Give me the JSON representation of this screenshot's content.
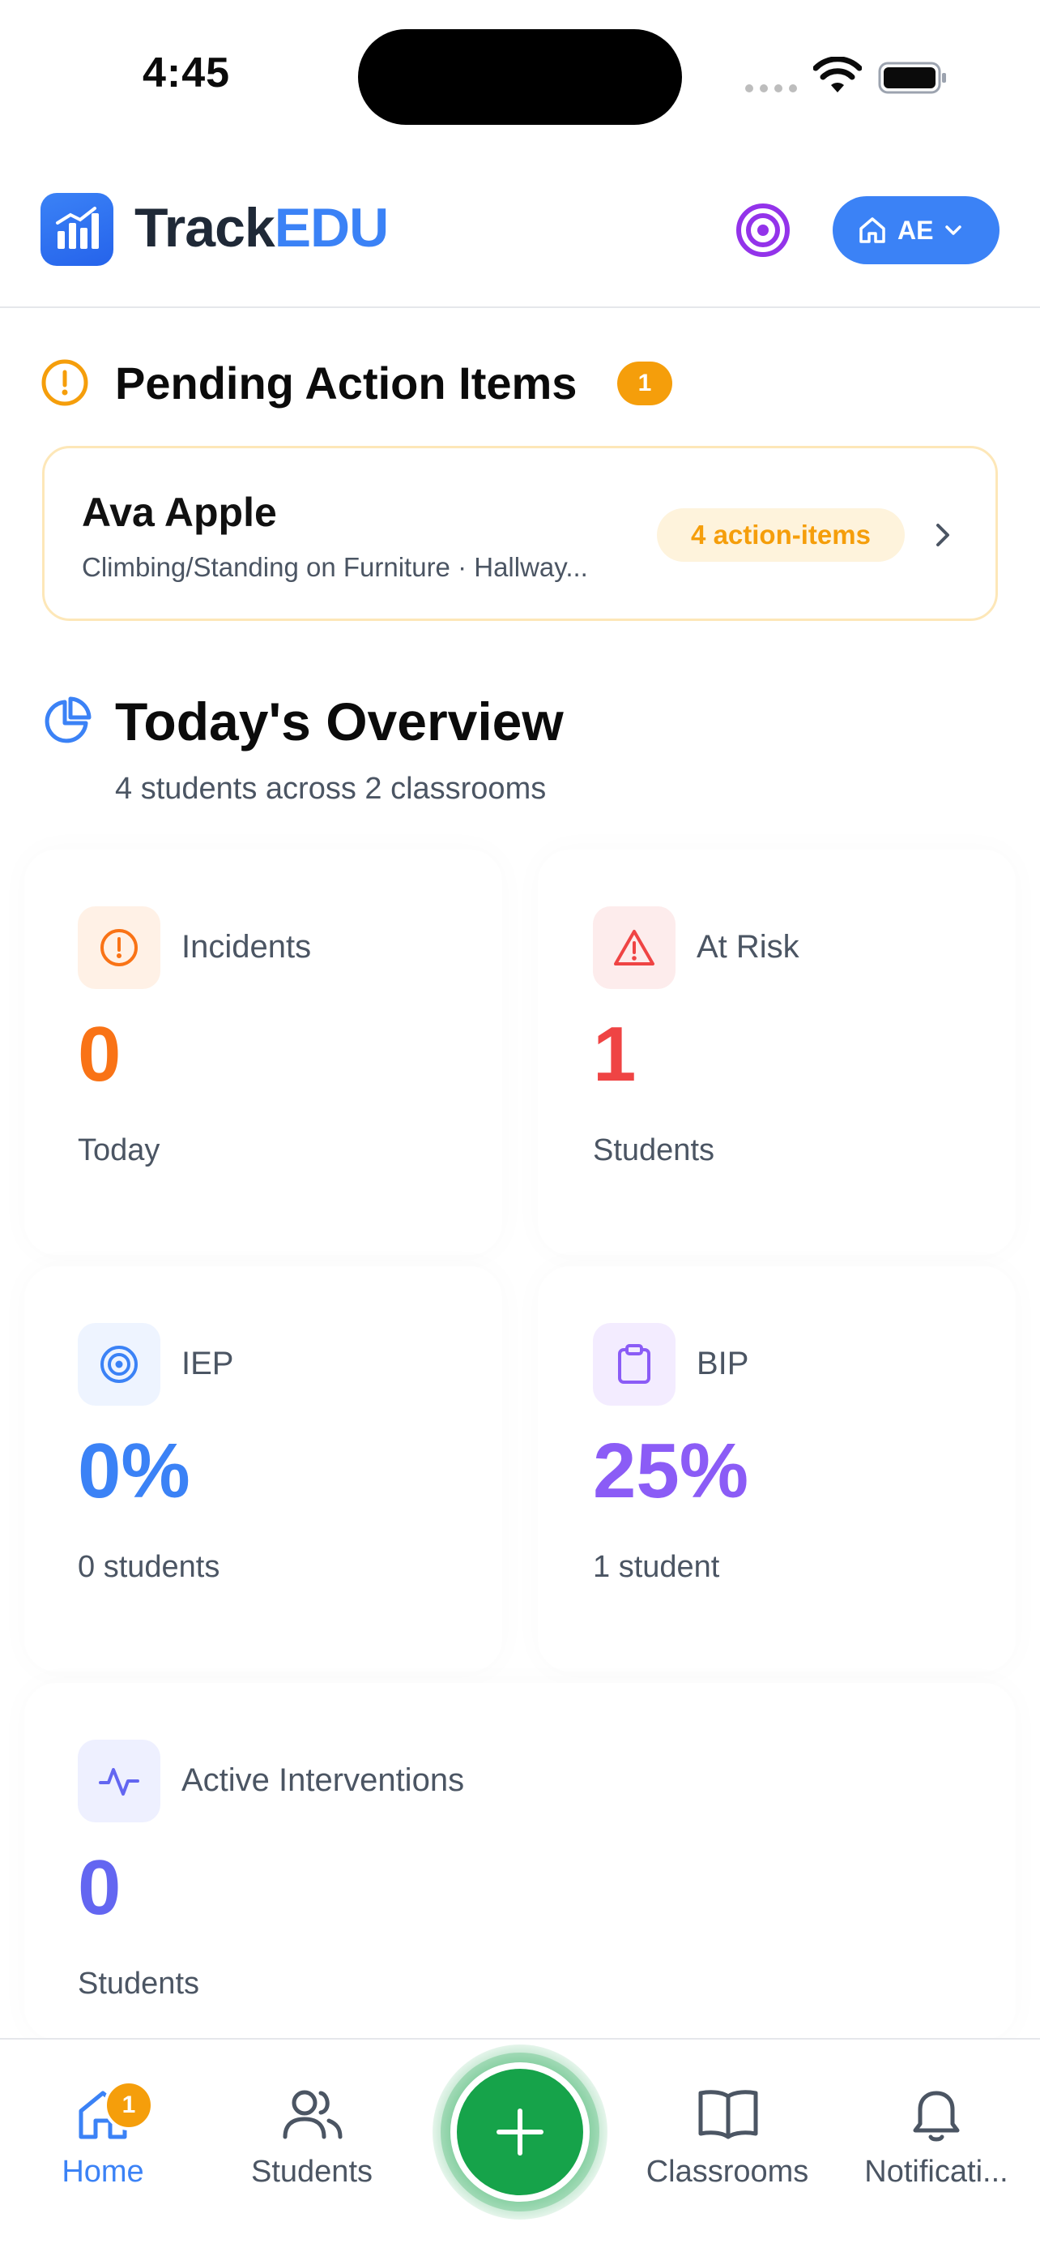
{
  "status_bar": {
    "time": "4:45"
  },
  "header": {
    "brand_part1": "Track",
    "brand_part2": "EDU",
    "profile_initials": "AE"
  },
  "pending": {
    "title": "Pending Action Items",
    "count": "1",
    "items": [
      {
        "name": "Ava Apple",
        "subtitle": "Climbing/Standing on Furniture · Hallway...",
        "badge": "4 action-items"
      }
    ]
  },
  "overview": {
    "title": "Today's Overview",
    "subtitle": "4 students across 2 classrooms",
    "stats": [
      {
        "label": "Incidents",
        "value": "0",
        "sub": "Today",
        "color": "#f97316",
        "icon": "alert-circle-icon"
      },
      {
        "label": "At Risk",
        "value": "1",
        "sub": "Students",
        "color": "#ef4444",
        "icon": "warning-triangle-icon"
      },
      {
        "label": "IEP",
        "value": "0%",
        "sub": "0 students",
        "color": "#3b82f6",
        "icon": "target-icon"
      },
      {
        "label": "BIP",
        "value": "25%",
        "sub": "1 student",
        "color": "#8b5cf6",
        "icon": "clipboard-icon"
      },
      {
        "label": "Active Interventions",
        "value": "0",
        "sub": "Students",
        "color": "#6366f1",
        "icon": "activity-icon"
      }
    ]
  },
  "nav": {
    "items": [
      {
        "label": "Home",
        "icon": "home-icon",
        "badge": "1",
        "active": true
      },
      {
        "label": "Students",
        "icon": "users-icon"
      },
      {
        "label": "Classrooms",
        "icon": "book-icon"
      },
      {
        "label": "Notificati...",
        "icon": "bell-icon"
      }
    ],
    "fab_icon": "plus-icon"
  },
  "colors": {
    "primary": "#3b82f6",
    "warning": "#f59e0b",
    "fab": "#16a34a",
    "purple": "#9333ea"
  }
}
